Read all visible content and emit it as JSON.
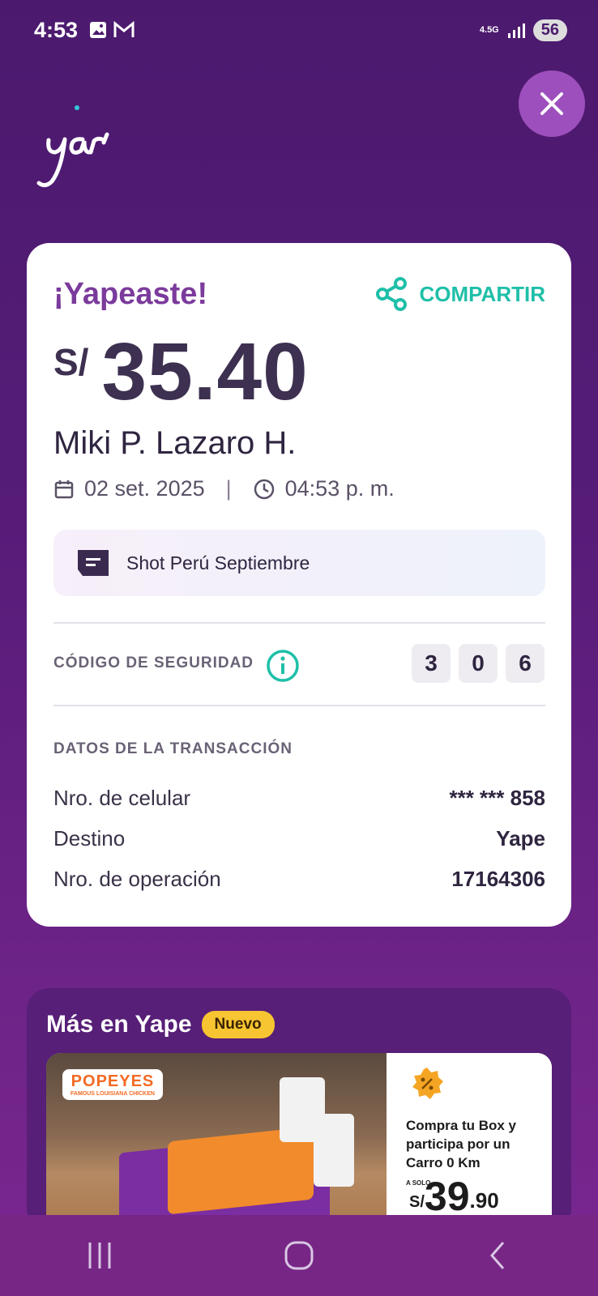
{
  "status_bar": {
    "time": "4:53",
    "network": "4.5G",
    "battery": "56"
  },
  "logo_text": "yape",
  "receipt": {
    "title": "¡Yapeaste!",
    "share_label": "COMPARTIR",
    "currency": "S/",
    "amount": "35.40",
    "recipient": "Miki P. Lazaro H.",
    "date": "02 set. 2025",
    "time": "04:53 p. m.",
    "message": "Shot Perú Septiembre",
    "security_label": "CÓDIGO DE SEGURIDAD",
    "security_code": [
      "3",
      "0",
      "6"
    ],
    "transaction_label": "DATOS DE LA TRANSACCIÓN",
    "rows": [
      {
        "key": "Nro. de celular",
        "value": "*** *** 858"
      },
      {
        "key": "Destino",
        "value": "Yape"
      },
      {
        "key": "Nro. de operación",
        "value": "17164306"
      }
    ]
  },
  "more": {
    "title": "Más en Yape",
    "badge": "Nuevo",
    "promo": {
      "brand": "POPEYES",
      "brand_tag": "FAMOUS LOUISIANA CHICKEN",
      "description": "Compra tu Box y participa por un Carro 0 Km",
      "price_prefix": "A SOLO",
      "price_currency": "S/",
      "price_whole": "39",
      "price_decimal": ".90"
    }
  },
  "colors": {
    "accent": "#1fbfa8",
    "brand": "#7b3b9c",
    "background": "#4b1a6e"
  }
}
